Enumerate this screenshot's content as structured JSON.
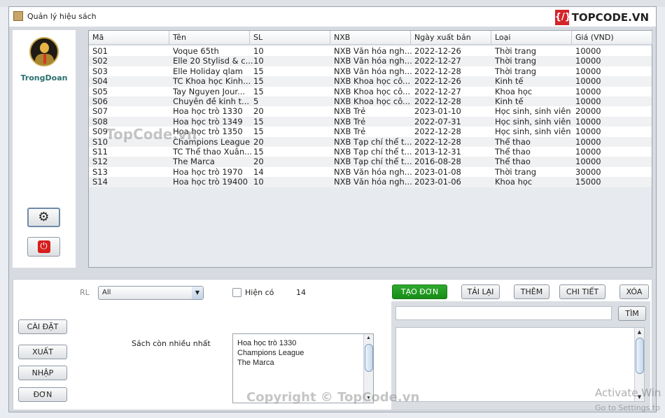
{
  "window": {
    "title": "Quản lý hiệu sách",
    "logo_text": "TOPCODE.VN"
  },
  "sidebar": {
    "username": "TrongDoan",
    "settings_icon": "gear-icon",
    "logout_icon": "power-icon"
  },
  "table": {
    "columns": [
      "Mã",
      "Tên",
      "SL",
      "NXB",
      "Ngày xuất bản",
      "Loại",
      "Giá (VND)"
    ],
    "rows": [
      [
        "S01",
        "Voque 65th",
        "10",
        "NXB Văn hóa ngh...",
        "2022-12-26",
        "Thời trang",
        "10000"
      ],
      [
        "S02",
        "Elle 20 Stylisd & c...",
        "10",
        "NXB Văn hóa ngh...",
        "2022-12-27",
        "Thời trang",
        "10000"
      ],
      [
        "S03",
        "Elle Holiday qlam",
        "15",
        "NXB Văn hóa ngh...",
        "2022-12-28",
        "Thời trang",
        "10000"
      ],
      [
        "S04",
        "TC Khoa học Kinh...",
        "15",
        "NXB Khoa học cô...",
        "2022-12-26",
        "Kinh tế",
        "10000"
      ],
      [
        "S05",
        "Tay Nguyen Jour...",
        "15",
        "NXB Khoa học cô...",
        "2022-12-27",
        "Khoa học",
        "10000"
      ],
      [
        "S06",
        "Chuyên đề kinh t...",
        "5",
        "NXB Khoa học cô...",
        "2022-12-28",
        "Kinh tế",
        "10000"
      ],
      [
        "S07",
        "Hoa học trò 1330",
        "20",
        "NXB Trẻ",
        "2023-01-10",
        "Học sinh, sinh viên",
        "20000"
      ],
      [
        "S08",
        "Hoa học trò 1349",
        "15",
        "NXB Trẻ",
        "2022-07-31",
        "Học sinh, sinh viên",
        "10000"
      ],
      [
        "S09",
        "Hoa học trò 1350",
        "15",
        "NXB Trẻ",
        "2022-12-28",
        "Học sinh, sinh viên",
        "10000"
      ],
      [
        "S10",
        "Champions League",
        "20",
        "NXB Tạp chí thể t...",
        "2022-12-28",
        "Thể thao",
        "10000"
      ],
      [
        "S11",
        "TC Thể thao Xuân...",
        "15",
        "NXB Tạp chí thể t...",
        "2013-12-31",
        "Thể thao",
        "10000"
      ],
      [
        "S12",
        "The Marca",
        "20",
        "NXB Tạp chí thể t...",
        "2016-08-28",
        "Thể thao",
        "10000"
      ],
      [
        "S13",
        "Hoa học trò 1970",
        "14",
        "NXB Văn hóa ngh...",
        "2023-01-08",
        "Thời trang",
        "30000"
      ],
      [
        "S14",
        "Hoa học trò 19400",
        "10",
        "NXB Văn hóa ngh...",
        "2023-01-06",
        "Khoa học",
        "15000"
      ]
    ]
  },
  "filters": {
    "rl_label": "RL",
    "rl_value": "All",
    "in_stock_label": "Hiện có",
    "in_stock_checked": false,
    "count": "14"
  },
  "left_buttons": [
    "CÀI ĐẶT",
    "XUẤT",
    "NHẬP",
    "ĐƠN"
  ],
  "most_stock": {
    "label": "Sách còn nhiều nhất",
    "items": [
      "Hoa học trò 1330",
      "Champions League",
      "The Marca"
    ]
  },
  "order": {
    "create": "TẠO ĐƠN",
    "reload": "TẢI LẠI",
    "add": "THÊM",
    "detail": "CHI TIẾT",
    "delete": "XÓA",
    "search_value": "",
    "find": "TÌM"
  },
  "colors": {
    "create_button": "#178c17",
    "username": "#2c6f6f",
    "logo_red": "#d4252a"
  },
  "watermarks": {
    "top": "TopCode.vn",
    "bottom": "Copyright © TopCode.vn",
    "activate": "Activate Win",
    "activate_sub": "Go to Settings to"
  }
}
